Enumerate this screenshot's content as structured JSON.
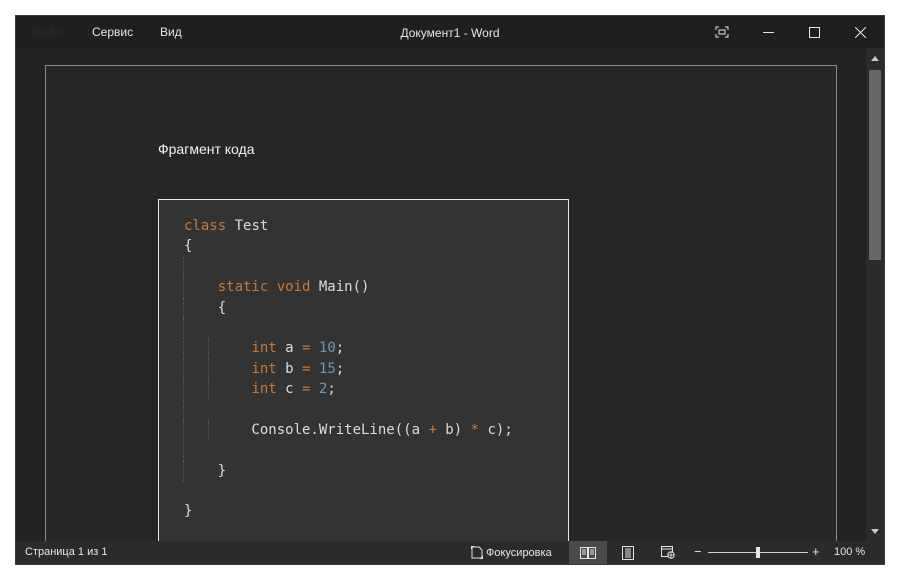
{
  "titlebar": {
    "menu": {
      "file": "Файл",
      "service": "Сервис",
      "view": "Вид"
    },
    "title": "Документ1  -  Word",
    "buttons": {
      "focus_icon": "focus-mode-icon",
      "minimize_icon": "minimize-icon",
      "maximize_icon": "maximize-icon",
      "close_icon": "close-icon"
    }
  },
  "document": {
    "heading": "Фрагмент кода",
    "code_lines": [
      {
        "parts": [
          {
            "t": "class",
            "c": "kw"
          },
          {
            "t": " Test",
            "c": ""
          }
        ],
        "guides": 0
      },
      {
        "parts": [
          {
            "t": "{",
            "c": ""
          }
        ],
        "guides": 0
      },
      {
        "parts": [],
        "guides": 1
      },
      {
        "parts": [
          {
            "t": "    ",
            "c": ""
          },
          {
            "t": "static",
            "c": "kw"
          },
          {
            "t": " ",
            "c": ""
          },
          {
            "t": "void",
            "c": "kw"
          },
          {
            "t": " Main()",
            "c": ""
          }
        ],
        "guides": 1
      },
      {
        "parts": [
          {
            "t": "    {",
            "c": ""
          }
        ],
        "guides": 1
      },
      {
        "parts": [],
        "guides": 1
      },
      {
        "parts": [
          {
            "t": "        ",
            "c": ""
          },
          {
            "t": "int",
            "c": "kw"
          },
          {
            "t": " a ",
            "c": ""
          },
          {
            "t": "=",
            "c": "op"
          },
          {
            "t": " ",
            "c": ""
          },
          {
            "t": "10",
            "c": "num"
          },
          {
            "t": ";",
            "c": ""
          }
        ],
        "guides": 2
      },
      {
        "parts": [
          {
            "t": "        ",
            "c": ""
          },
          {
            "t": "int",
            "c": "kw"
          },
          {
            "t": " b ",
            "c": ""
          },
          {
            "t": "=",
            "c": "op"
          },
          {
            "t": " ",
            "c": ""
          },
          {
            "t": "15",
            "c": "num"
          },
          {
            "t": ";",
            "c": ""
          }
        ],
        "guides": 2
      },
      {
        "parts": [
          {
            "t": "        ",
            "c": ""
          },
          {
            "t": "int",
            "c": "kw"
          },
          {
            "t": " c ",
            "c": ""
          },
          {
            "t": "=",
            "c": "op"
          },
          {
            "t": " ",
            "c": ""
          },
          {
            "t": "2",
            "c": "num"
          },
          {
            "t": ";",
            "c": ""
          }
        ],
        "guides": 2
      },
      {
        "parts": [],
        "guides": 1
      },
      {
        "parts": [
          {
            "t": "        Console.WriteLine((a ",
            "c": ""
          },
          {
            "t": "+",
            "c": "op"
          },
          {
            "t": " b) ",
            "c": ""
          },
          {
            "t": "*",
            "c": "op"
          },
          {
            "t": " c);",
            "c": ""
          }
        ],
        "guides": 2
      },
      {
        "parts": [],
        "guides": 1
      },
      {
        "parts": [
          {
            "t": "    }",
            "c": ""
          }
        ],
        "guides": 1
      },
      {
        "parts": [],
        "guides": 0
      },
      {
        "parts": [
          {
            "t": "}",
            "c": ""
          }
        ],
        "guides": 0
      }
    ]
  },
  "statusbar": {
    "page": "Страница 1 из 1",
    "focus": "Фокусировка",
    "views": [
      "read-mode-icon",
      "print-layout-icon",
      "web-layout-icon"
    ],
    "zoom_minus": "−",
    "zoom_plus": "+",
    "zoom_level": "100 %",
    "zoom_fraction": 0.5
  },
  "colors": {
    "keyword": "#cc7832",
    "number": "#6897bb",
    "text": "#dcdcdc",
    "background": "#262626"
  }
}
